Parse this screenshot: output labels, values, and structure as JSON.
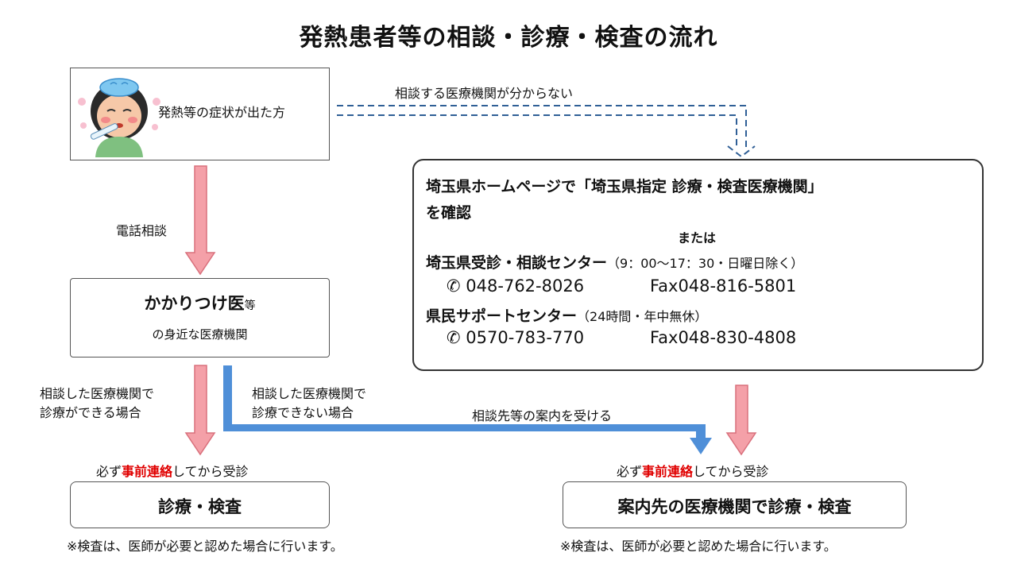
{
  "title": "発熱患者等の相談・診療・検査の流れ",
  "patient": {
    "label": "発熱等の症状が出た方",
    "illustration": "sick-person-with-thermometer"
  },
  "flows": {
    "unknown_facility": "相談する医療機関が分からない",
    "phone_consult": "電話相談",
    "can_treat_line1": "相談した医療機関で",
    "can_treat_line2": "診療ができる場合",
    "cannot_treat_line1": "相談した医療機関で",
    "cannot_treat_line2": "診療できない場合",
    "referral": "相談先等の案内を受ける"
  },
  "doctor": {
    "main": "かかりつけ医",
    "main_small": "等",
    "sub": "の身近な医療機関"
  },
  "info": {
    "line1": "埼玉県ホームページで「埼玉県指定 診療・検査医療機関」",
    "line2": "を確認",
    "or": "または",
    "center1_name": "埼玉県受診・相談センター",
    "center1_hours": "（9：00～17：30・日曜日除く）",
    "center1_tel": "048-762-8026",
    "center1_fax": "Fax048-816-5801",
    "center2_name": "県民サポートセンター",
    "center2_hours": "（24時間・年中無休）",
    "center2_tel": "0570-783-770",
    "center2_fax": "Fax048-830-4808"
  },
  "contact_notice": {
    "prefix": "必ず",
    "highlight": "事前連絡",
    "suffix": "してから受診"
  },
  "results": {
    "left": "診療・検査",
    "right": "案内先の医療機関で診療・検査",
    "note": "※検査は、医師が必要と認めた場合に行います。"
  },
  "colors": {
    "pink_arrow_fill": "#f4a0a8",
    "pink_arrow_stroke": "#d9707c",
    "blue_arrow": "#4f8fd8",
    "dashed_arrow": "#2f5f96",
    "highlight": "#e00000"
  }
}
